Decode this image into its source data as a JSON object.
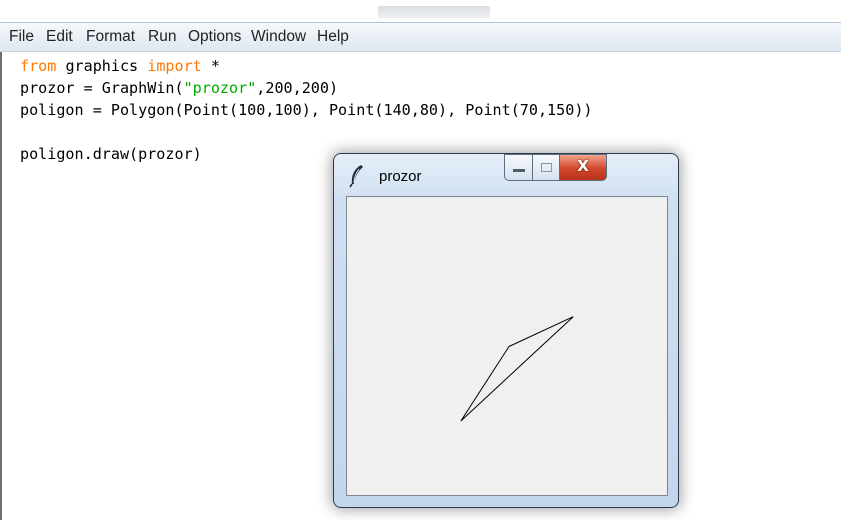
{
  "menubar": {
    "items": [
      "File",
      "Edit",
      "Format",
      "Run",
      "Options",
      "Window",
      "Help"
    ]
  },
  "editor": {
    "lines": [
      [
        {
          "t": "from",
          "c": "kw"
        },
        {
          "t": " graphics "
        },
        {
          "t": "import",
          "c": "kw"
        },
        {
          "t": " *"
        }
      ],
      [
        {
          "t": "prozor = GraphWin("
        },
        {
          "t": "\"prozor\"",
          "c": "str"
        },
        {
          "t": ",200,200)"
        }
      ],
      [
        {
          "t": "poligon = Polygon(Point(100,100), Point(140,80), Point(70,150))"
        }
      ],
      [],
      [
        {
          "t": "poligon.draw(prozor)"
        }
      ]
    ]
  },
  "tk_window": {
    "title": "prozor",
    "close_glyph": "X",
    "canvas_background": "#f0f0f0",
    "polygon_points": [
      [
        100,
        100
      ],
      [
        140,
        80
      ],
      [
        70,
        150
      ]
    ],
    "canvas_units": [
      200,
      200
    ]
  },
  "colors": {
    "keyword": "#ff7700",
    "string": "#00aa00",
    "close_button": "#c8442a"
  }
}
